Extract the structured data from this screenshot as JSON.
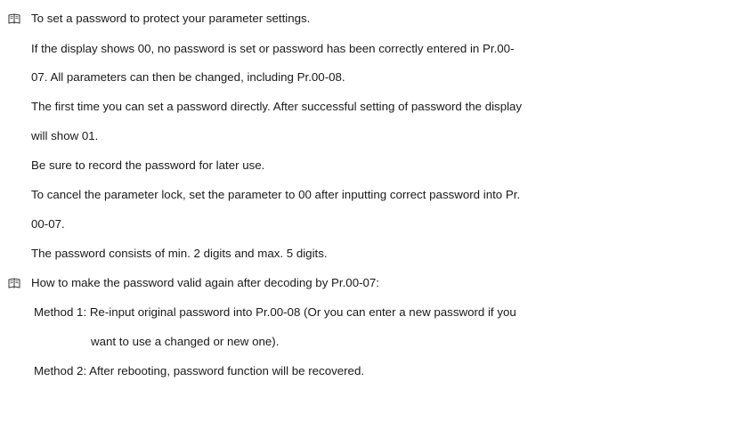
{
  "note1": {
    "icon": "book-icon",
    "lines": [
      "To set a password to protect your parameter settings.",
      "If the display shows 00, no password is set or password has been correctly entered in Pr.00-",
      "07. All parameters can then be changed, including Pr.00-08.",
      "The first time you can set a password directly. After successful setting of password the display",
      "will show 01.",
      "Be sure to record the password for later use.",
      "To cancel the parameter lock, set the parameter to 00 after inputting correct password into Pr.",
      "00-07.",
      "The password consists of min. 2 digits and max. 5 digits."
    ]
  },
  "note2": {
    "icon": "book-icon",
    "lines": [
      "How to make the password valid again after decoding by Pr.00-07:",
      "Method 1: Re-input original password into Pr.00-08 (Or you can enter a new password if you",
      "want to use a changed or new one).",
      "Method 2: After rebooting, password function will be recovered."
    ]
  }
}
